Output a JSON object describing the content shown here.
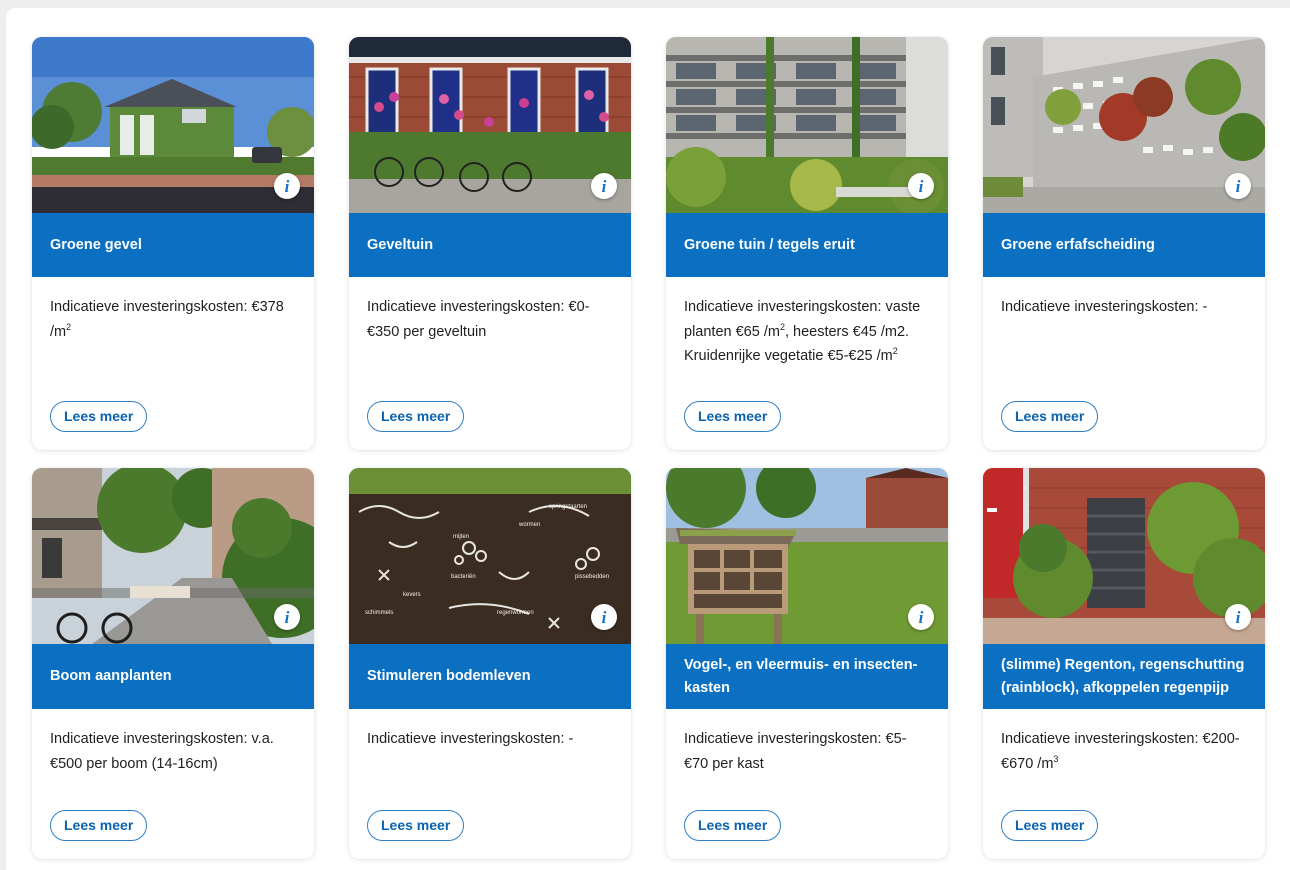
{
  "cards": [
    {
      "title": "Groene gevel",
      "text_html": "Indicatieve investeringskosten: €378 /m<sup>2</sup>",
      "button": "Lees meer",
      "info": "i",
      "scene": "green-facade"
    },
    {
      "title": "Geveltuin",
      "text_html": "Indicatieve investeringskosten: €0-€350 per geveltuin",
      "button": "Lees meer",
      "info": "i",
      "scene": "facade-garden"
    },
    {
      "title": "Groene tuin / tegels eruit",
      "text_html": "Indicatieve investeringskosten: vaste planten €65 /m<sup>2</sup>, heesters €45 /m2. Kruidenrijke vegetatie €5-€25 /m<sup>2</sup>",
      "button": "Lees meer",
      "info": "i",
      "scene": "green-garden"
    },
    {
      "title": "Groene erfafscheiding",
      "text_html": "Indicatieve investeringskosten: -",
      "button": "Lees meer",
      "info": "i",
      "scene": "green-fence"
    },
    {
      "title": "Boom aanplanten",
      "text_html": "Indicatieve investeringskosten: v.a. €500 per boom (14-16cm)",
      "button": "Lees meer",
      "info": "i",
      "scene": "street-trees"
    },
    {
      "title": "Stimuleren bodemleven",
      "text_html": "Indicatieve investeringskosten: -",
      "button": "Lees meer",
      "info": "i",
      "scene": "soil-life",
      "soil_labels": [
        "mijten",
        "bacteriën",
        "wormen",
        "pissebedden",
        "schimmels",
        "kevers",
        "regenwormen",
        "springstaarten"
      ]
    },
    {
      "title": "Vogel-, en vleermuis- en insecten­kasten",
      "text_html": "Indicatieve investeringskosten: €5-€70 per kast",
      "button": "Lees meer",
      "info": "i",
      "scene": "insect-hotel"
    },
    {
      "title": "(slimme) Regenton, regenschutting (rainblock), afkoppelen regenpijp",
      "text_html": "Indicatieve investeringskosten: €200-€670 /m<sup>3</sup>",
      "button": "Lees meer",
      "info": "i",
      "scene": "rain-barrel"
    }
  ],
  "colors": {
    "accent": "#0b70c1",
    "button_border": "#2f7fc6",
    "button_text": "#0b63b0",
    "page_bg": "#eeeeef"
  }
}
